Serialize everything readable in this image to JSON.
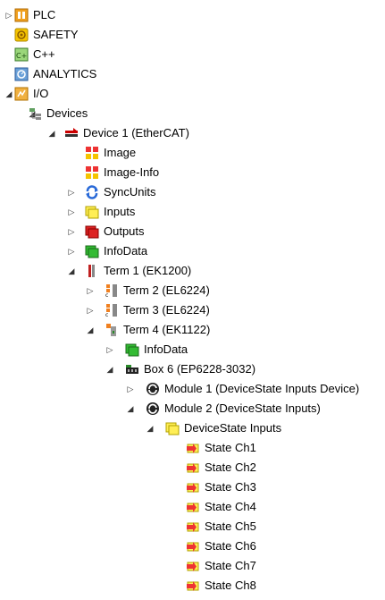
{
  "tree": [
    {
      "label": "PLC",
      "icon": "plc-icon",
      "expand": "collapsed"
    },
    {
      "label": "SAFETY",
      "icon": "safety-icon",
      "expand": "none"
    },
    {
      "label": "C++",
      "icon": "cpp-icon",
      "expand": "none"
    },
    {
      "label": "ANALYTICS",
      "icon": "analytics-icon",
      "expand": "none"
    },
    {
      "label": "I/O",
      "icon": "io-icon",
      "expand": "expanded"
    },
    {
      "label": "Devices",
      "icon": "devices-icon",
      "expand": "expanded"
    },
    {
      "label": "Device 1 (EtherCAT)",
      "icon": "ethercat-device-icon",
      "expand": "expanded"
    },
    {
      "label": "Image",
      "icon": "image-icon",
      "expand": "none"
    },
    {
      "label": "Image-Info",
      "icon": "image-info-icon",
      "expand": "none"
    },
    {
      "label": "SyncUnits",
      "icon": "syncunits-icon",
      "expand": "collapsed"
    },
    {
      "label": "Inputs",
      "icon": "inputs-icon",
      "expand": "collapsed"
    },
    {
      "label": "Outputs",
      "icon": "outputs-icon",
      "expand": "collapsed"
    },
    {
      "label": "InfoData",
      "icon": "infodata-icon",
      "expand": "collapsed"
    },
    {
      "label": "Term 1 (EK1200)",
      "icon": "coupler-terminal-icon",
      "expand": "expanded"
    },
    {
      "label": "Term 2 (EL6224)",
      "icon": "io-link-terminal-icon",
      "expand": "collapsed"
    },
    {
      "label": "Term 3 (EL6224)",
      "icon": "io-link-terminal-icon",
      "expand": "collapsed"
    },
    {
      "label": "Term 4 (EK1122)",
      "icon": "junction-terminal-icon",
      "expand": "expanded"
    },
    {
      "label": "InfoData",
      "icon": "infodata-icon",
      "expand": "collapsed"
    },
    {
      "label": "Box 6 (EP6228-3032)",
      "icon": "box-module-icon",
      "expand": "expanded"
    },
    {
      "label": "Module 1 (DeviceState Inputs Device)",
      "icon": "module-icon",
      "expand": "collapsed"
    },
    {
      "label": "Module 2 (DeviceState Inputs)",
      "icon": "module-icon",
      "expand": "expanded"
    },
    {
      "label": "DeviceState Inputs",
      "icon": "inputs-icon",
      "expand": "expanded"
    },
    {
      "label": "State Ch1",
      "icon": "input-variable-icon",
      "expand": "none"
    },
    {
      "label": "State Ch2",
      "icon": "input-variable-icon",
      "expand": "none"
    },
    {
      "label": "State Ch3",
      "icon": "input-variable-icon",
      "expand": "none"
    },
    {
      "label": "State Ch4",
      "icon": "input-variable-icon",
      "expand": "none"
    },
    {
      "label": "State Ch5",
      "icon": "input-variable-icon",
      "expand": "none"
    },
    {
      "label": "State Ch6",
      "icon": "input-variable-icon",
      "expand": "none"
    },
    {
      "label": "State Ch7",
      "icon": "input-variable-icon",
      "expand": "none"
    },
    {
      "label": "State Ch8",
      "icon": "input-variable-icon",
      "expand": "none"
    }
  ]
}
